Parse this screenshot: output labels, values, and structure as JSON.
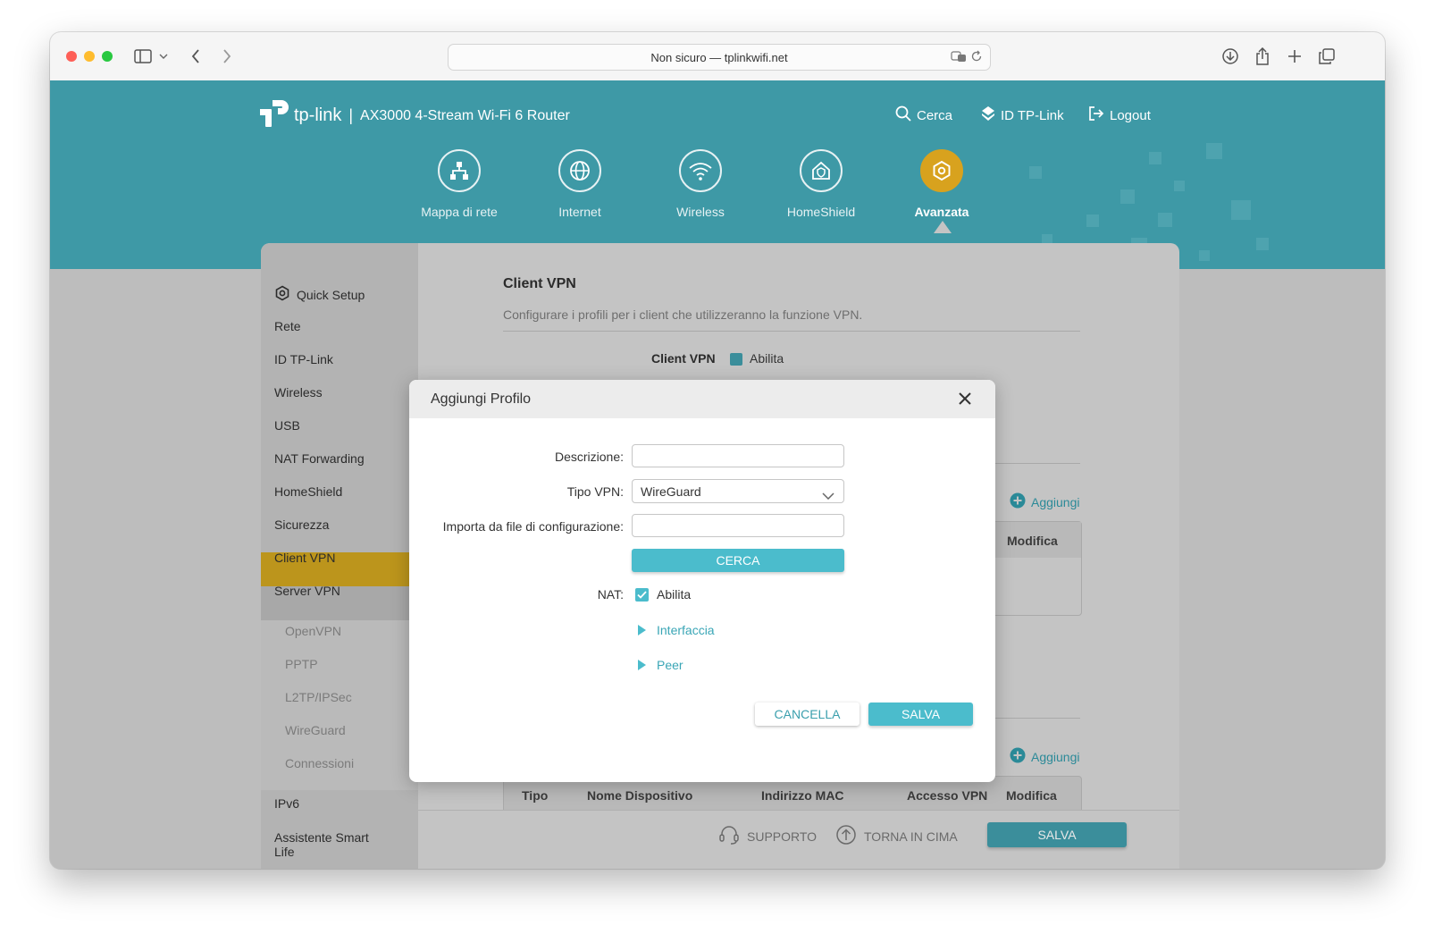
{
  "browser": {
    "url_text": "Non sicuro — tplinkwifi.net",
    "icons": [
      "sidebar-icon",
      "chevron-down-icon",
      "back-icon",
      "forward-icon",
      "translate-icon",
      "reload-icon",
      "download-icon",
      "share-icon",
      "new-tab-icon",
      "tabs-icon"
    ]
  },
  "header": {
    "brand": "tp-link",
    "separator": "|",
    "product": "AX3000 4-Stream Wi-Fi 6 Router",
    "search": "Cerca",
    "tplink_id": "ID TP-Link",
    "logout": "Logout"
  },
  "nav": {
    "items": [
      {
        "label": "Mappa di rete",
        "icon": "network-map-icon"
      },
      {
        "label": "Internet",
        "icon": "globe-icon"
      },
      {
        "label": "Wireless",
        "icon": "wifi-icon"
      },
      {
        "label": "HomeShield",
        "icon": "home-shield-icon"
      },
      {
        "label": "Avanzata",
        "icon": "advanced-gear-icon",
        "active": true
      }
    ]
  },
  "sidebar": {
    "items": [
      "Quick Setup",
      "Rete",
      "ID TP-Link",
      "Wireless",
      "USB",
      "NAT Forwarding",
      "HomeShield",
      "Sicurezza",
      "Client VPN",
      "Server VPN"
    ],
    "sub_items": [
      "OpenVPN",
      "PPTP",
      "L2TP/IPSec",
      "WireGuard",
      "Connessioni"
    ],
    "bottom_items": [
      "IPv6",
      "Assistente Smart Life"
    ],
    "active": "Client VPN"
  },
  "main": {
    "title": "Client VPN",
    "description": "Configurare i profili per i client che utilizzeranno la funzione VPN.",
    "partial_label": "Client VPN",
    "partial_check": "Abilita",
    "add_label": "Aggiungi",
    "table1_edit": "Modifica",
    "table2_headers": [
      "Tipo",
      "Nome Dispositivo",
      "Indirizzo MAC",
      "Accesso VPN",
      "Modifica"
    ]
  },
  "footer": {
    "support": "SUPPORTO",
    "back_to_top": "TORNA IN CIMA",
    "save": "SALVA"
  },
  "modal": {
    "title": "Aggiungi Profilo",
    "description_label": "Descrizione:",
    "description_value": "",
    "vpn_type_label": "Tipo VPN:",
    "vpn_type_value": "WireGuard",
    "import_label": "Importa da file di configurazione:",
    "import_value": "",
    "browse_button": "CERCA",
    "nat_label": "NAT:",
    "nat_checkbox": "Abilita",
    "nat_enabled": true,
    "interface_section": "Interfaccia",
    "peer_section": "Peer",
    "cancel_button": "CANCELLA",
    "save_button": "SALVA"
  },
  "colors": {
    "brand_teal": "#3e99a6",
    "accent_teal": "#4bbccc",
    "active_gold": "#d8a21e",
    "sidebar_active": "#bc951c"
  }
}
